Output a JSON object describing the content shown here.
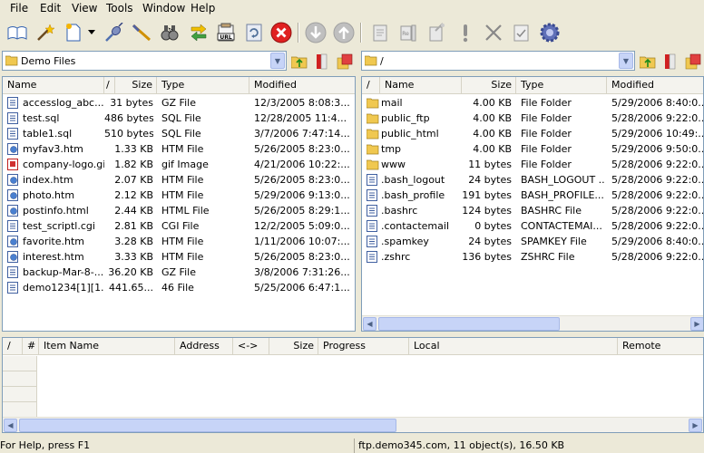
{
  "menu": [
    "File",
    "Edit",
    "View",
    "Tools",
    "Window",
    "Help"
  ],
  "toolbar": {
    "buttons": [
      "open-book-icon",
      "magic-wand-icon",
      "new-file-icon",
      "dropdown-arrow-icon",
      "connect-icon",
      "disconnect-icon",
      "binoculars-icon",
      "transfer-icon",
      "url-icon",
      "refresh-icon",
      "stop-icon",
      "down-arrow-icon",
      "up-arrow-icon",
      "properties-icon",
      "rename-icon",
      "new-folder-icon",
      "exclamation-icon",
      "delete-icon",
      "checklist-icon",
      "settings-gear-icon"
    ]
  },
  "local": {
    "path": "Demo Files",
    "columns": {
      "name": "Name",
      "sort": "/",
      "size": "Size",
      "type": "Type",
      "modified": "Modified"
    },
    "files": [
      {
        "name": "accesslog_abc...",
        "size": "31 bytes",
        "type": "GZ File",
        "modified": "12/3/2005 8:08:3...",
        "icon": "gz"
      },
      {
        "name": "test.sql",
        "size": "486 bytes",
        "type": "SQL File",
        "modified": "12/28/2005 11:4...",
        "icon": "sql"
      },
      {
        "name": "table1.sql",
        "size": "510 bytes",
        "type": "SQL File",
        "modified": "3/7/2006 7:47:14...",
        "icon": "sql"
      },
      {
        "name": "myfav3.htm",
        "size": "1.33 KB",
        "type": "HTM File",
        "modified": "5/26/2005 8:23:0...",
        "icon": "htm"
      },
      {
        "name": "company-logo.gif",
        "size": "1.82 KB",
        "type": "gif Image",
        "modified": "4/21/2006 10:22:...",
        "icon": "gif"
      },
      {
        "name": "index.htm",
        "size": "2.07 KB",
        "type": "HTM File",
        "modified": "5/26/2005 8:23:0...",
        "icon": "htm"
      },
      {
        "name": "photo.htm",
        "size": "2.12 KB",
        "type": "HTM File",
        "modified": "5/29/2006 9:13:0...",
        "icon": "htm"
      },
      {
        "name": "postinfo.html",
        "size": "2.44 KB",
        "type": "HTML File",
        "modified": "5/26/2005 8:29:1...",
        "icon": "htm"
      },
      {
        "name": "test_scriptl.cgi",
        "size": "2.81 KB",
        "type": "CGI File",
        "modified": "12/2/2005 5:09:0...",
        "icon": "cgi"
      },
      {
        "name": "favorite.htm",
        "size": "3.28 KB",
        "type": "HTM File",
        "modified": "1/11/2006 10:07:...",
        "icon": "htm"
      },
      {
        "name": "interest.htm",
        "size": "3.33 KB",
        "type": "HTM File",
        "modified": "5/26/2005 8:23:0...",
        "icon": "htm"
      },
      {
        "name": "backup-Mar-8-...",
        "size": "36.20 KB",
        "type": "GZ File",
        "modified": "3/8/2006 7:31:26...",
        "icon": "gz"
      },
      {
        "name": "demo1234[1][1...",
        "size": "441.65...",
        "type": "46 File",
        "modified": "5/25/2006 6:47:1...",
        "icon": "gz"
      }
    ]
  },
  "remote": {
    "path": "/",
    "columns": {
      "sort": "/",
      "name": "Name",
      "size": "Size",
      "type": "Type",
      "modified": "Modified"
    },
    "files": [
      {
        "name": "mail",
        "size": "4.00 KB",
        "type": "File Folder",
        "modified": "5/29/2006 8:40:0...",
        "icon": "folder"
      },
      {
        "name": "public_ftp",
        "size": "4.00 KB",
        "type": "File Folder",
        "modified": "5/28/2006 9:22:0...",
        "icon": "folder"
      },
      {
        "name": "public_html",
        "size": "4.00 KB",
        "type": "File Folder",
        "modified": "5/29/2006 10:49:...",
        "icon": "folder"
      },
      {
        "name": "tmp",
        "size": "4.00 KB",
        "type": "File Folder",
        "modified": "5/29/2006 9:50:0...",
        "icon": "folder"
      },
      {
        "name": "www",
        "size": "11 bytes",
        "type": "File Folder",
        "modified": "5/28/2006 9:22:0...",
        "icon": "folder"
      },
      {
        "name": ".bash_logout",
        "size": "24 bytes",
        "type": "BASH_LOGOUT ...",
        "modified": "5/28/2006 9:22:0...",
        "icon": "doc"
      },
      {
        "name": ".bash_profile",
        "size": "191 bytes",
        "type": "BASH_PROFILE...",
        "modified": "5/28/2006 9:22:0...",
        "icon": "doc"
      },
      {
        "name": ".bashrc",
        "size": "124 bytes",
        "type": "BASHRC File",
        "modified": "5/28/2006 9:22:0...",
        "icon": "doc"
      },
      {
        "name": ".contactemail",
        "size": "0 bytes",
        "type": "CONTACTEMAI...",
        "modified": "5/28/2006 9:22:0...",
        "icon": "doc"
      },
      {
        "name": ".spamkey",
        "size": "24 bytes",
        "type": "SPAMKEY File",
        "modified": "5/29/2006 8:40:0...",
        "icon": "doc"
      },
      {
        "name": ".zshrc",
        "size": "136 bytes",
        "type": "ZSHRC File",
        "modified": "5/28/2006 9:22:0...",
        "icon": "doc"
      }
    ]
  },
  "queue": {
    "columns": {
      "sort": "/",
      "num": "#",
      "item": "Item Name",
      "address": "Address",
      "dir": "<->",
      "size": "Size",
      "progress": "Progress",
      "local": "Local",
      "remote": "Remote"
    }
  },
  "status": {
    "left": "For Help, press F1",
    "right": "ftp.demo345.com, 11 object(s), 16.50 KB"
  },
  "colors": {
    "pane_border": "#7f9db9",
    "folder": "#f0c850",
    "accent": "#316ac5"
  }
}
